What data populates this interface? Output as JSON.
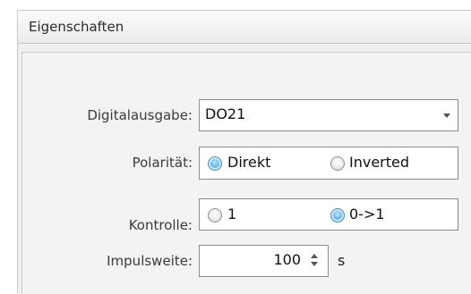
{
  "panel": {
    "title": "Eigenschaften"
  },
  "digital_output": {
    "label": "Digitalausgabe:",
    "value": "DO21"
  },
  "polarity": {
    "label": "Polarität:",
    "options": [
      {
        "label": "Direkt",
        "checked": true
      },
      {
        "label": "Inverted",
        "checked": false
      }
    ]
  },
  "control": {
    "label": "Kontrolle:",
    "options": [
      {
        "label": "1",
        "checked": false
      },
      {
        "label": "0->1",
        "checked": true
      }
    ]
  },
  "pulse_width": {
    "label": "Impulsweite:",
    "value": "100",
    "unit": "s"
  },
  "colors": {
    "accent": "#5aaeeb",
    "border": "#8c8c8c",
    "panel_bg": "#f0f0f0"
  }
}
